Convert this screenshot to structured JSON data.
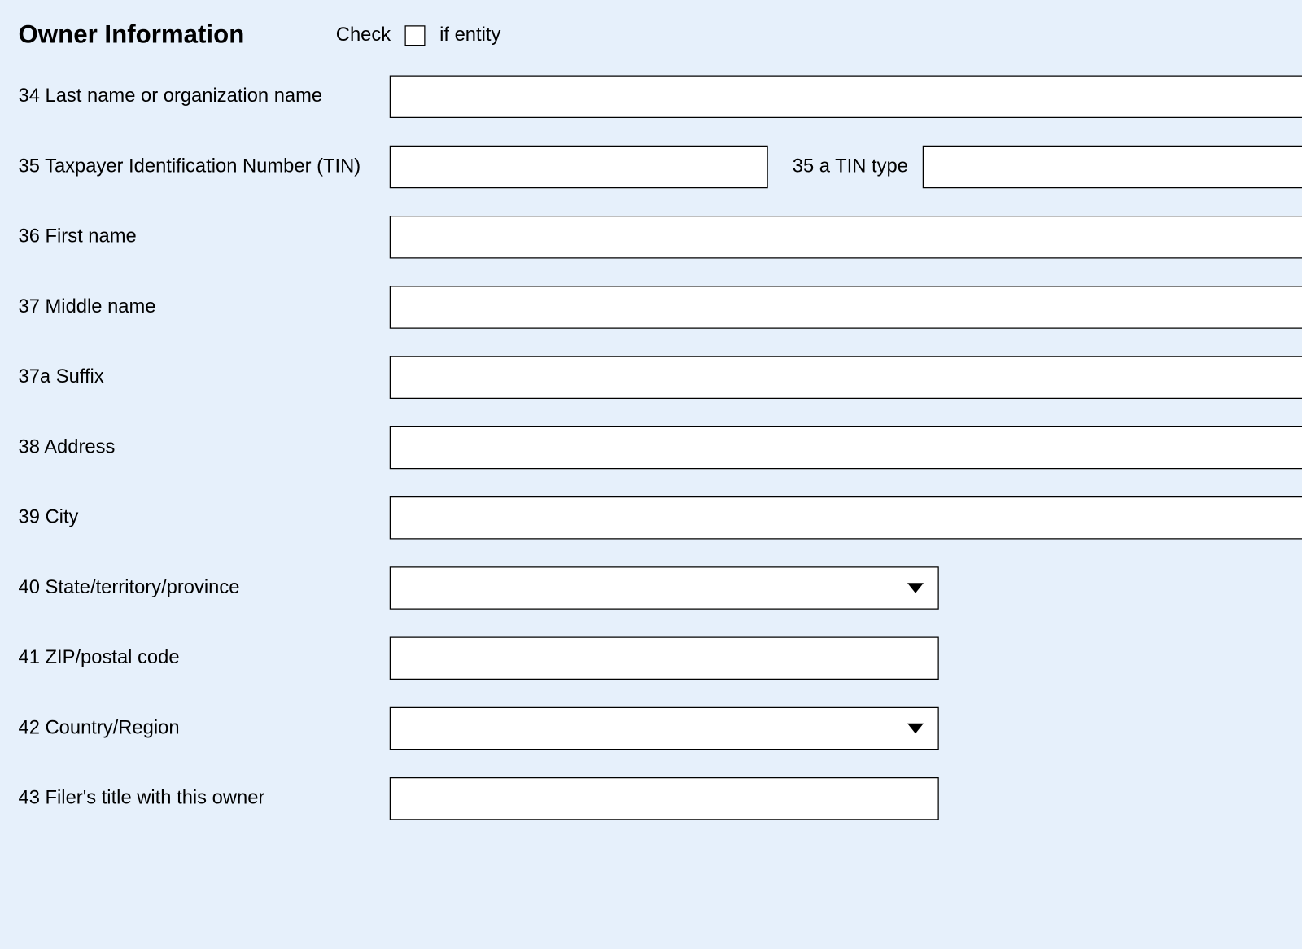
{
  "section": {
    "title": "Owner Information",
    "check_label_left": "Check",
    "check_label_right": "if entity",
    "entity_checked": false,
    "buttons": {
      "add": "+",
      "remove": "-"
    }
  },
  "fields": {
    "f34": {
      "label": "34 Last name  or organization name",
      "value": ""
    },
    "f35": {
      "label": "35 Taxpayer Identification Number (TIN)",
      "value": ""
    },
    "f35a": {
      "label": "35 a TIN type",
      "value": ""
    },
    "f36": {
      "label": "36  First name",
      "value": ""
    },
    "f37": {
      "label": "37  Middle name",
      "value": ""
    },
    "f37a": {
      "label": "37a Suffix",
      "value": ""
    },
    "f38": {
      "label": "38  Address",
      "value": ""
    },
    "f39": {
      "label": "39  City",
      "value": ""
    },
    "f40": {
      "label": "40 State/territory/province",
      "value": ""
    },
    "f41": {
      "label": "41 ZIP/postal code",
      "value": ""
    },
    "f42": {
      "label": " 42 Country/Region",
      "value": ""
    },
    "f43": {
      "label": "43 Filer's title with this owner",
      "value": ""
    }
  }
}
